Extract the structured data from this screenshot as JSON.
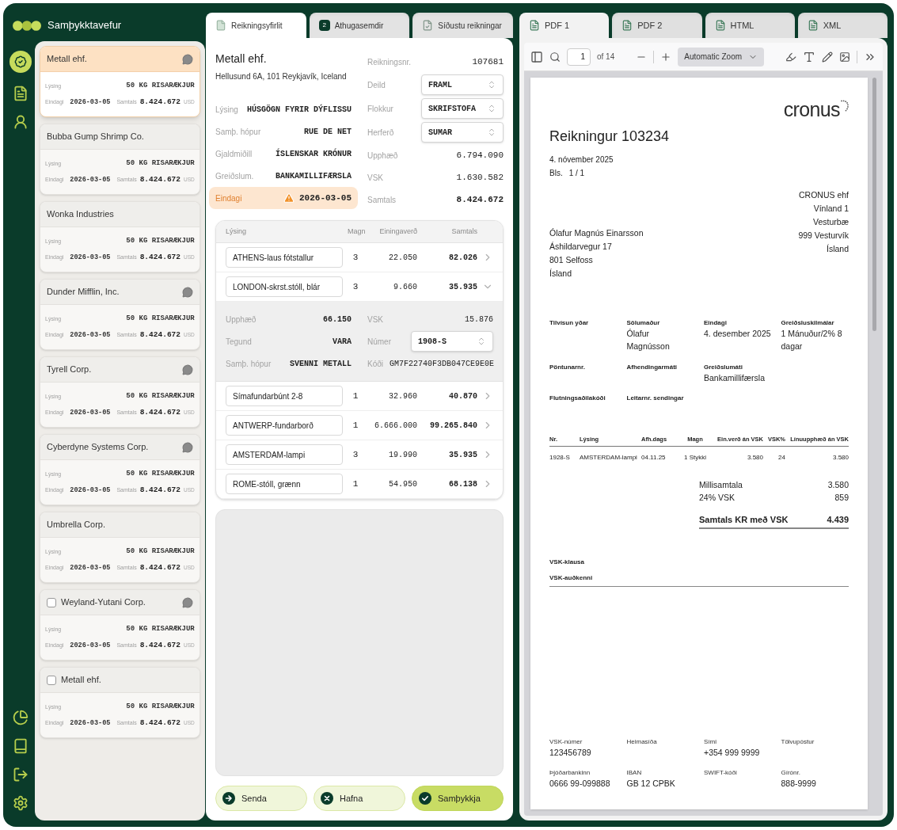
{
  "app": {
    "title": "Samþykktavefur"
  },
  "nav": {
    "top": [
      {
        "selected": true
      },
      {
        "selected": false
      },
      {
        "selected": false
      }
    ],
    "bottom": [
      {
        "selected": false
      },
      {
        "selected": false
      },
      {
        "selected": false
      },
      {
        "selected": false
      }
    ]
  },
  "invoices": [
    {
      "name": "Metall ehf.",
      "selected": true,
      "kind": "plain",
      "comments": true,
      "description_label": "Lýsing",
      "description": "50 KG RISARÆKJUR",
      "due_label": "Eindagi",
      "due": "2026-03-05",
      "total_label": "Samtals",
      "total": "8.424.672",
      "currency": "USD"
    },
    {
      "name": "Bubba Gump Shrimp Co.",
      "selected": false,
      "kind": "plain",
      "comments": false,
      "description_label": "Lýsing",
      "description": "50 KG RISARÆKJUR",
      "due_label": "Eindagi",
      "due": "2026-03-05",
      "total_label": "Samtals",
      "total": "8.424.672",
      "currency": "USD"
    },
    {
      "name": "Wonka Industries",
      "selected": false,
      "kind": "plain",
      "comments": false,
      "description_label": "Lýsing",
      "description": "50 KG RISARÆKJUR",
      "due_label": "Eindagi",
      "due": "2026-03-05",
      "total_label": "Samtals",
      "total": "8.424.672",
      "currency": "USD"
    },
    {
      "name": "Dunder Mifflin, Inc.",
      "selected": false,
      "kind": "plain",
      "comments": true,
      "description_label": "Lýsing",
      "description": "50 KG RISARÆKJUR",
      "due_label": "Eindagi",
      "due": "2026-03-05",
      "total_label": "Samtals",
      "total": "8.424.672",
      "currency": "USD"
    },
    {
      "name": "Tyrell Corp.",
      "selected": false,
      "kind": "plain",
      "comments": true,
      "description_label": "Lýsing",
      "description": "50 KG RISARÆKJUR",
      "due_label": "Eindagi",
      "due": "2026-03-05",
      "total_label": "Samtals",
      "total": "8.424.672",
      "currency": "USD"
    },
    {
      "name": "Cyberdyne Systems Corp.",
      "selected": false,
      "kind": "plain",
      "comments": true,
      "description_label": "Lýsing",
      "description": "50 KG RISARÆKJUR",
      "due_label": "Eindagi",
      "due": "2026-03-05",
      "total_label": "Samtals",
      "total": "8.424.672",
      "currency": "USD"
    },
    {
      "name": "Umbrella Corp.",
      "selected": false,
      "kind": "plain",
      "comments": false,
      "description_label": "Lýsing",
      "description": "50 KG RISARÆKJUR",
      "due_label": "Eindagi",
      "due": "2026-03-05",
      "total_label": "Samtals",
      "total": "8.424.672",
      "currency": "USD"
    },
    {
      "name": "Weyland-Yutani Corp.",
      "selected": false,
      "kind": "checkbox",
      "checked": false,
      "comments": true,
      "description_label": "Lýsing",
      "description": "50 KG RISARÆKJUR",
      "due_label": "Eindagi",
      "due": "2026-03-05",
      "total_label": "Samtals",
      "total": "8.424.672",
      "currency": "USD"
    },
    {
      "name": "Metall ehf.",
      "selected": false,
      "kind": "checkbox",
      "checked": false,
      "comments": false,
      "description_label": "Lýsing",
      "description": "50 KG RISARÆKJUR",
      "due_label": "Eindagi",
      "due": "2026-03-05",
      "total_label": "Samtals",
      "total": "8.424.672",
      "currency": "USD"
    }
  ],
  "detail_tabs": [
    {
      "label": "Reikningsyfirlit",
      "selected": true
    },
    {
      "label": "Athugasemdir",
      "badge": "2",
      "selected": false
    },
    {
      "label": "Síðustu reikningar",
      "selected": false
    }
  ],
  "vendor": {
    "name": "Metall ehf.",
    "address": "Hellusund 6A, 101 Reykjavík, Iceland"
  },
  "summary_left": [
    {
      "label": "Lýsing",
      "value": "HÚSGÖGN FYRIR DÝFLISSU",
      "kind": "text"
    },
    {
      "label": "Samþ. hópur",
      "value": "RUE DE NET",
      "kind": "text"
    },
    {
      "label": "Gjaldmiðill",
      "value": "ÍSLENSKAR KRÓNUR",
      "kind": "text"
    },
    {
      "label": "Greiðslum.",
      "value": "BANKAMILLIFÆRSLA",
      "kind": "text"
    },
    {
      "label": "Eindagi",
      "value": "2026-03-05",
      "kind": "warning"
    }
  ],
  "summary_right": [
    {
      "label": "Reikningsnr.",
      "value": "107681",
      "kind": "text"
    },
    {
      "label": "Deild",
      "value": "FRAML",
      "kind": "select"
    },
    {
      "label": "Flokkur",
      "value": "SKRIFSTOFA",
      "kind": "select"
    },
    {
      "label": "Herferð",
      "value": "SUMAR",
      "kind": "select"
    },
    {
      "label": "Upphæð",
      "value": "6.794.090",
      "kind": "text"
    },
    {
      "label": "VSK",
      "value": "1.630.582",
      "kind": "text"
    },
    {
      "label": "Samtals",
      "value": "8.424.672",
      "kind": "total"
    }
  ],
  "lines": {
    "columns": [
      "Lýsing",
      "Magn",
      "Einingaverð",
      "Samtals"
    ],
    "rows": [
      {
        "description": "ATHENS-laus fótstallur",
        "qty": "3",
        "unit_price": "22.050",
        "total": "82.026",
        "expanded": false
      },
      {
        "description": "LONDON-skrst.stóll, blár",
        "qty": "3",
        "unit_price": "9.660",
        "total": "35.935",
        "expanded": true,
        "details": {
          "left": [
            {
              "label": "Upphæð",
              "value": "66.150"
            },
            {
              "label": "Tegund",
              "value": "VARA"
            },
            {
              "label": "Samþ. hópur",
              "value": "SVENNI METALL"
            }
          ],
          "right": [
            {
              "label": "VSK",
              "value": "15.876",
              "kind": "text"
            },
            {
              "label": "Númer",
              "value": "1908-S",
              "kind": "select"
            },
            {
              "label": "Kóði",
              "value": "GM7F22740F3DB047CE9E0E",
              "kind": "text"
            }
          ]
        }
      },
      {
        "description": "Símafundarbúnt 2-8",
        "qty": "1",
        "unit_price": "32.960",
        "total": "40.870",
        "expanded": false
      },
      {
        "description": "ANTWERP-fundarborð",
        "qty": "1",
        "unit_price": "6.666.000",
        "total": "99.265.840",
        "expanded": false
      },
      {
        "description": "AMSTERDAM-lampi",
        "qty": "3",
        "unit_price": "19.990",
        "total": "35.935",
        "expanded": false
      },
      {
        "description": "ROME-stóll, grænn",
        "qty": "1",
        "unit_price": "54.950",
        "total": "68.138",
        "expanded": false
      }
    ]
  },
  "actions": [
    {
      "label": "Senda",
      "kind": "secondary"
    },
    {
      "label": "Hafna",
      "kind": "secondary"
    },
    {
      "label": "Samþykkja",
      "kind": "primary"
    }
  ],
  "viewer": {
    "tabs": [
      {
        "label": "PDF 1",
        "selected": true
      },
      {
        "label": "PDF 2",
        "selected": false
      },
      {
        "label": "HTML",
        "selected": false
      },
      {
        "label": "XML",
        "selected": false
      }
    ],
    "page_number": "1",
    "page_count": "of 14",
    "zoom": "Automatic Zoom"
  },
  "document": {
    "logo": "cronus",
    "title": "Reikningur 103234",
    "date": "4. nóvember 2025",
    "page_label": "Bls.",
    "page": "1 / 1",
    "customer": [
      "Ólafur Magnús Einarsson",
      "Áshildarvegur 17",
      "801 Selfoss",
      "Ísland"
    ],
    "seller": [
      "CRONUS ehf",
      "Vínland 1",
      "Vesturbæ",
      "999 Vesturvík",
      "Ísland"
    ],
    "info": [
      [
        {
          "label": "Tilvísun yðar"
        },
        {
          "label": "Sölumaður",
          "value": "Ólafur Magnússon"
        },
        {
          "label": "Eindagi",
          "value": "4. desember 2025"
        },
        {
          "label": "Greiðsluskilmálar",
          "value": "1 Mánuður/2% 8 dagar"
        }
      ],
      [
        {
          "label": "Pöntunarnr."
        },
        {
          "label": "Afhendingarmáti"
        },
        {
          "label": "Greiðslumáti",
          "value": "Bankamillifærsla"
        }
      ],
      [
        {
          "label": "Flutningsaðilakóði"
        },
        {
          "label": "Leitarnr. sendingar"
        }
      ]
    ],
    "table": {
      "columns": [
        "Nr.",
        "Lýsing",
        "Afh.dags",
        "Magn",
        "Ein.verð án VSK",
        "VSK%",
        "Línuupphæð án VSK"
      ],
      "rows": [
        [
          "1928-S",
          "AMSTERDAM-lampi",
          "04.11.25",
          "1 Stykki",
          "3.580",
          "24",
          "3.580"
        ]
      ]
    },
    "totals": [
      {
        "label": "Millisamtala",
        "value": "3.580"
      },
      {
        "label": "24% VSK",
        "value": "859"
      }
    ],
    "grand_total": {
      "label": "Samtals KR með VSK",
      "value": "4.439"
    },
    "vat_lines": [
      "VSK-klausa",
      "VSK-auðkenni"
    ],
    "footer": [
      {
        "label": "VSK-númer",
        "value": "123456789"
      },
      {
        "label": "Heimasíða"
      },
      {
        "label": "Sími",
        "value": "+354 999 9999"
      },
      {
        "label": "Tölvupóstur"
      },
      {
        "label": "Þjóðarbankinn",
        "value": "0666 99-099888"
      },
      {
        "label": "IBAN",
        "value": "GB 12 CPBK"
      },
      {
        "label": "SWIFT-kóði"
      },
      {
        "label": "Gírónr.",
        "value": "888-9999"
      }
    ]
  }
}
